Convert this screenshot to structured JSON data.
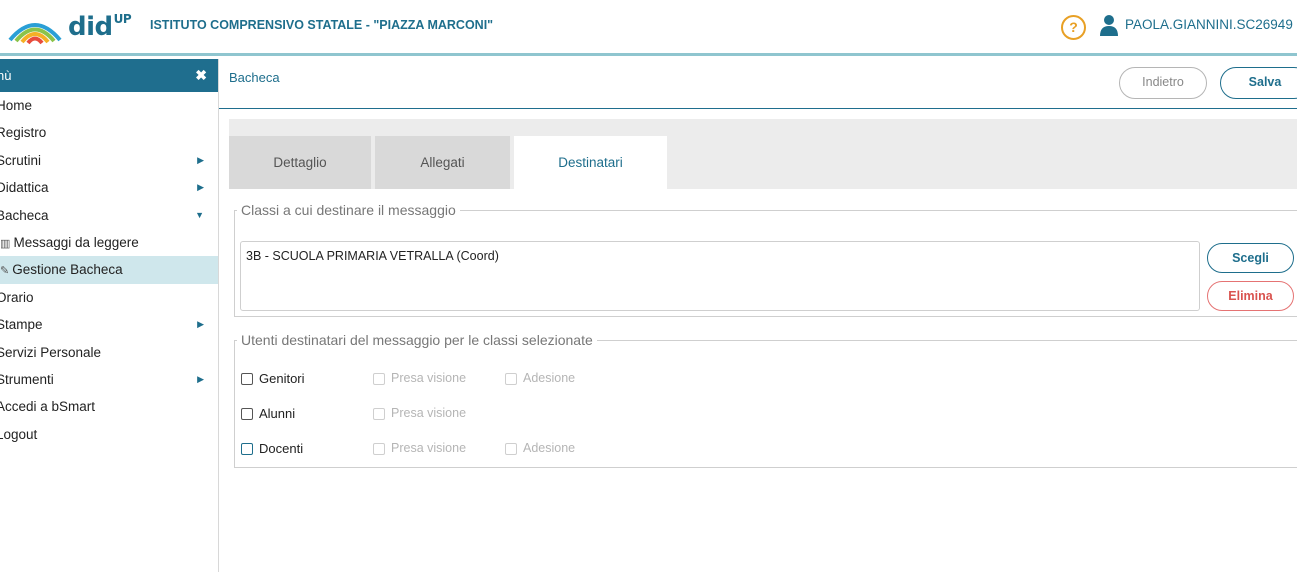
{
  "header": {
    "brand": "did",
    "brand_sup": "UP",
    "school": "ISTITUTO COMPRENSIVO STATALE - \"PIAZZA MARCONI\"",
    "help": "?",
    "user": "PAOLA.GIANNINI.SC26949"
  },
  "sidebar": {
    "title": "nù",
    "close": "✖",
    "items": [
      {
        "label": "Home"
      },
      {
        "label": "Registro"
      },
      {
        "label": "Scrutini",
        "arrow": "▶"
      },
      {
        "label": "Didattica",
        "arrow": "▶"
      },
      {
        "label": "Bacheca",
        "arrow": "▼"
      },
      {
        "label": "Messaggi da leggere"
      },
      {
        "label": "Gestione Bacheca"
      },
      {
        "label": "Orario"
      },
      {
        "label": "Stampe",
        "arrow": "▶"
      },
      {
        "label": "Servizi Personale"
      },
      {
        "label": "Strumenti",
        "arrow": "▶"
      },
      {
        "label": "Accedi a bSmart"
      },
      {
        "label": "Logout"
      }
    ]
  },
  "topbar": {
    "breadcrumb": "Bacheca",
    "back_label": "Indietro",
    "save_label": "Salva"
  },
  "tabs": [
    {
      "label": "Dettaglio"
    },
    {
      "label": "Allegati"
    },
    {
      "label": "Destinatari"
    }
  ],
  "classes": {
    "legend": "Classi a cui destinare il messaggio",
    "value": "3B - SCUOLA PRIMARIA VETRALLA (Coord)",
    "choose_label": "Scegli",
    "remove_label": "Elimina"
  },
  "recipients": {
    "legend": "Utenti destinatari del messaggio per le classi selezionate",
    "rows": [
      {
        "label": "Genitori",
        "presa": "Presa visione",
        "adesione": "Adesione"
      },
      {
        "label": "Alunni",
        "presa": "Presa visione"
      },
      {
        "label": "Docenti",
        "presa": "Presa visione",
        "adesione": "Adesione"
      }
    ]
  },
  "colors": {
    "primary": "#1f6e8e",
    "active_bg": "#cfe7ec",
    "danger": "#d9534f",
    "help": "#e8a025"
  }
}
